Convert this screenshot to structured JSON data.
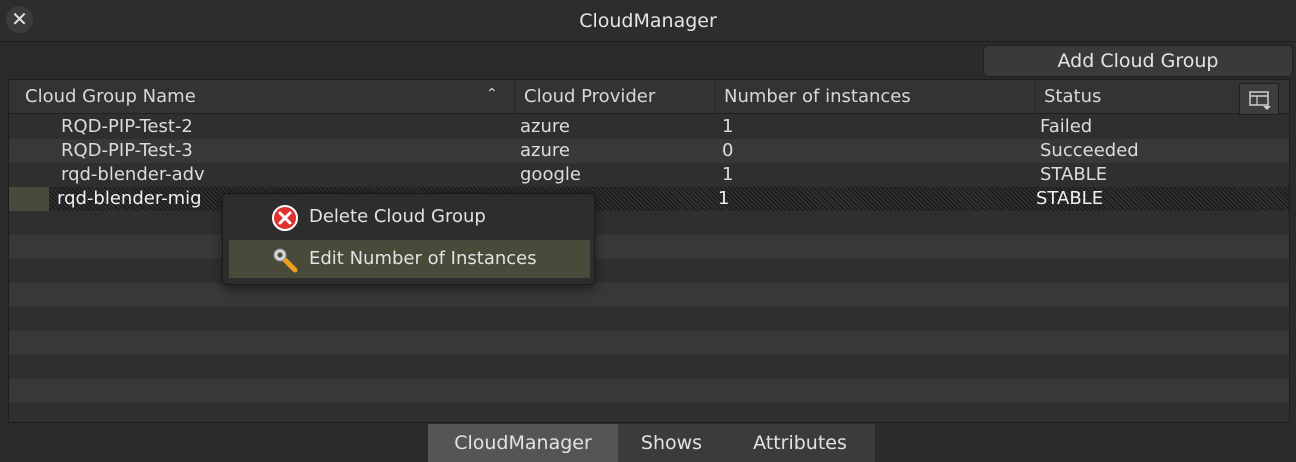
{
  "window": {
    "title": "CloudManager"
  },
  "toolbar": {
    "add_label": "Add Cloud Group"
  },
  "table": {
    "columns": [
      "Cloud Group Name",
      "Cloud Provider",
      "Number of instances",
      "Status"
    ],
    "sort": {
      "column": "Cloud Group Name",
      "direction": "ascending"
    },
    "rows": [
      {
        "name": "RQD-PIP-Test-2",
        "provider": "azure",
        "instances": "1",
        "status": "Failed"
      },
      {
        "name": "RQD-PIP-Test-3",
        "provider": "azure",
        "instances": "0",
        "status": "Succeeded"
      },
      {
        "name": "rqd-blender-adv",
        "provider": "google",
        "instances": "1",
        "status": "STABLE"
      },
      {
        "name": "rqd-blender-mig",
        "provider": "",
        "instances": "1",
        "status": "STABLE"
      }
    ],
    "selected_row": 3
  },
  "context_menu": {
    "items": [
      {
        "label": "Delete Cloud Group",
        "icon": "delete-icon"
      },
      {
        "label": "Edit Number of Instances",
        "icon": "wrench-icon"
      }
    ],
    "highlighted": 1
  },
  "tabs": [
    {
      "label": "CloudManager",
      "active": true
    },
    {
      "label": "Shows",
      "active": false
    },
    {
      "label": "Attributes",
      "active": false
    }
  ],
  "colors": {
    "background": "#2b2b2b",
    "highlight": "#4a4a3a",
    "delete_icon": "#e03030",
    "wrench_icon": "#f0a020"
  }
}
